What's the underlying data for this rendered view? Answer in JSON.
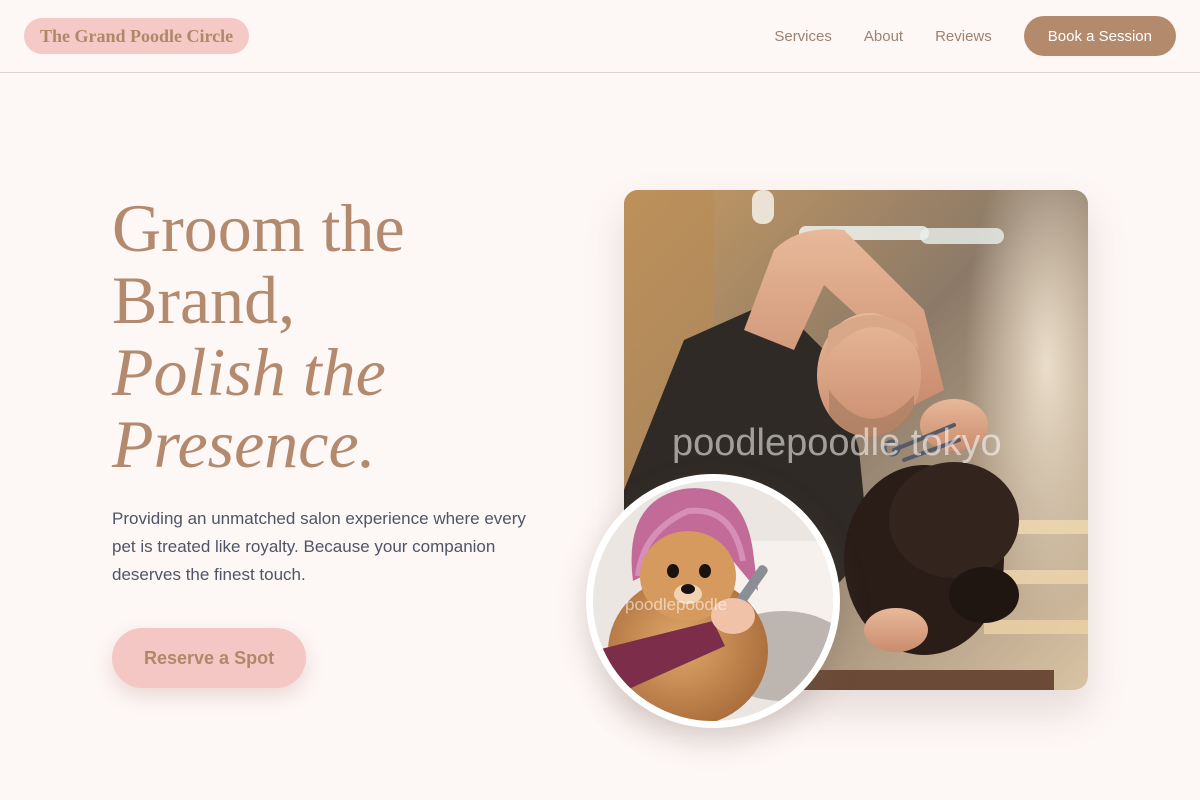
{
  "header": {
    "brand": "The Grand Poodle Circle",
    "nav": [
      {
        "label": "Services"
      },
      {
        "label": "About"
      },
      {
        "label": "Reviews"
      }
    ],
    "book_label": "Book a Session"
  },
  "hero": {
    "headline_line1": "Groom the",
    "headline_line2": "Brand,",
    "headline_line3": "Polish the",
    "headline_line4": "Presence.",
    "lead": "Providing an unmatched salon experience where every pet is treated like royalty. Because your companion deserves the finest touch.",
    "cta_label": "Reserve a Spot"
  },
  "images": {
    "main_watermark": "poodlepoodle tokyo",
    "circle_watermark": "poodlepoodle"
  },
  "colors": {
    "background": "#fdf7f6",
    "accent": "#b48a6d",
    "pink": "#f4c7c4",
    "text": "#4f5566"
  }
}
